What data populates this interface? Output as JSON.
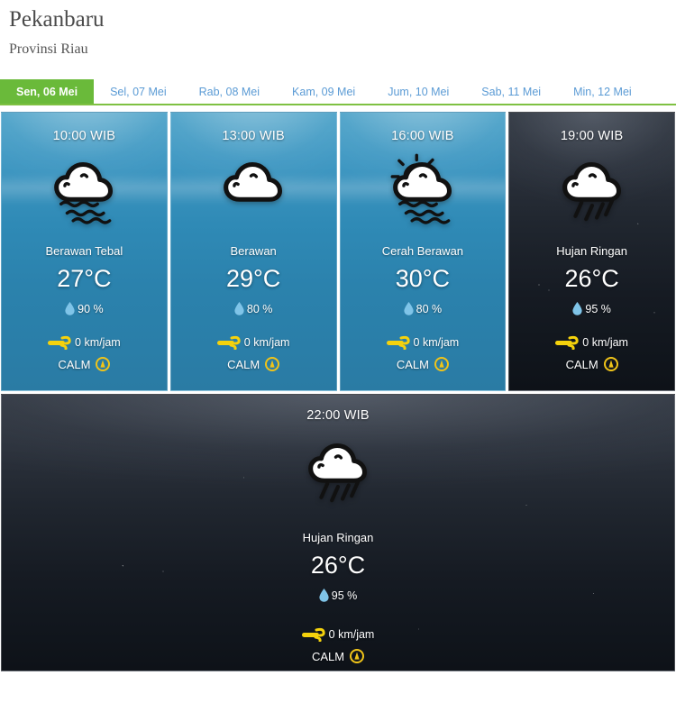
{
  "header": {
    "city": "Pekanbaru",
    "province": "Provinsi Riau"
  },
  "tabs": [
    {
      "label": "Sen, 06 Mei",
      "active": true
    },
    {
      "label": "Sel, 07 Mei",
      "active": false
    },
    {
      "label": "Rab, 08 Mei",
      "active": false
    },
    {
      "label": "Kam, 09 Mei",
      "active": false
    },
    {
      "label": "Jum, 10 Mei",
      "active": false
    },
    {
      "label": "Sab, 11 Mei",
      "active": false
    },
    {
      "label": "Min, 12 Mei",
      "active": false
    }
  ],
  "colors": {
    "active_tab_green": "#6aba3a",
    "tab_link_blue": "#5b9bd5",
    "wind_yellow": "#f5d20c",
    "droplet_blue": "#7fc4e8",
    "compass_gold": "#f0c419"
  },
  "units": {
    "humidity_suffix": "%",
    "wind_suffix": "km/jam",
    "temp_suffix": "°C"
  },
  "forecasts": [
    {
      "time": "10:00 WIB",
      "icon": "cloud-haze-icon",
      "condition": "Berawan Tebal",
      "temperature": "27°C",
      "humidity": "90 %",
      "wind_speed": "0 km/jam",
      "wind_direction": "CALM",
      "night": false
    },
    {
      "time": "13:00 WIB",
      "icon": "cloud-icon",
      "condition": "Berawan",
      "temperature": "29°C",
      "humidity": "80 %",
      "wind_speed": "0 km/jam",
      "wind_direction": "CALM",
      "night": false
    },
    {
      "time": "16:00 WIB",
      "icon": "sun-cloud-haze-icon",
      "condition": "Cerah Berawan",
      "temperature": "30°C",
      "humidity": "80 %",
      "wind_speed": "0 km/jam",
      "wind_direction": "CALM",
      "night": false
    },
    {
      "time": "19:00 WIB",
      "icon": "rain-cloud-icon",
      "condition": "Hujan Ringan",
      "temperature": "26°C",
      "humidity": "95 %",
      "wind_speed": "0 km/jam",
      "wind_direction": "CALM",
      "night": true
    },
    {
      "time": "22:00 WIB",
      "icon": "rain-cloud-icon",
      "condition": "Hujan Ringan",
      "temperature": "26°C",
      "humidity": "95 %",
      "wind_speed": "0 km/jam",
      "wind_direction": "CALM",
      "night": true
    }
  ]
}
